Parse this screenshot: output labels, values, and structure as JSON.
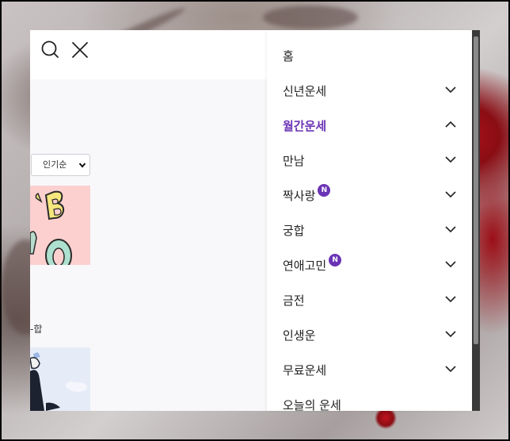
{
  "header": {
    "search_icon": "search-icon",
    "close_icon": "close-icon"
  },
  "content": {
    "sort_selected": "인기순",
    "partial_label": "-합"
  },
  "menu": {
    "items": [
      {
        "label": "홈",
        "badge": "",
        "chevron": "none",
        "active": false
      },
      {
        "label": "신년운세",
        "badge": "",
        "chevron": "down",
        "active": false
      },
      {
        "label": "월간운세",
        "badge": "",
        "chevron": "up",
        "active": true
      },
      {
        "label": "만남",
        "badge": "",
        "chevron": "down",
        "active": false
      },
      {
        "label": "짝사랑",
        "badge": "N",
        "chevron": "down",
        "active": false
      },
      {
        "label": "궁합",
        "badge": "",
        "chevron": "down",
        "active": false
      },
      {
        "label": "연애고민",
        "badge": "N",
        "chevron": "down",
        "active": false
      },
      {
        "label": "금전",
        "badge": "",
        "chevron": "down",
        "active": false
      },
      {
        "label": "인생운",
        "badge": "",
        "chevron": "down",
        "active": false
      },
      {
        "label": "무료운세",
        "badge": "",
        "chevron": "down",
        "active": false
      },
      {
        "label": "오늘의 운세",
        "badge": "",
        "chevron": "none",
        "active": false
      }
    ]
  },
  "colors": {
    "accent": "#6b34b6",
    "text": "#222222",
    "panel": "#f8f8fa"
  }
}
